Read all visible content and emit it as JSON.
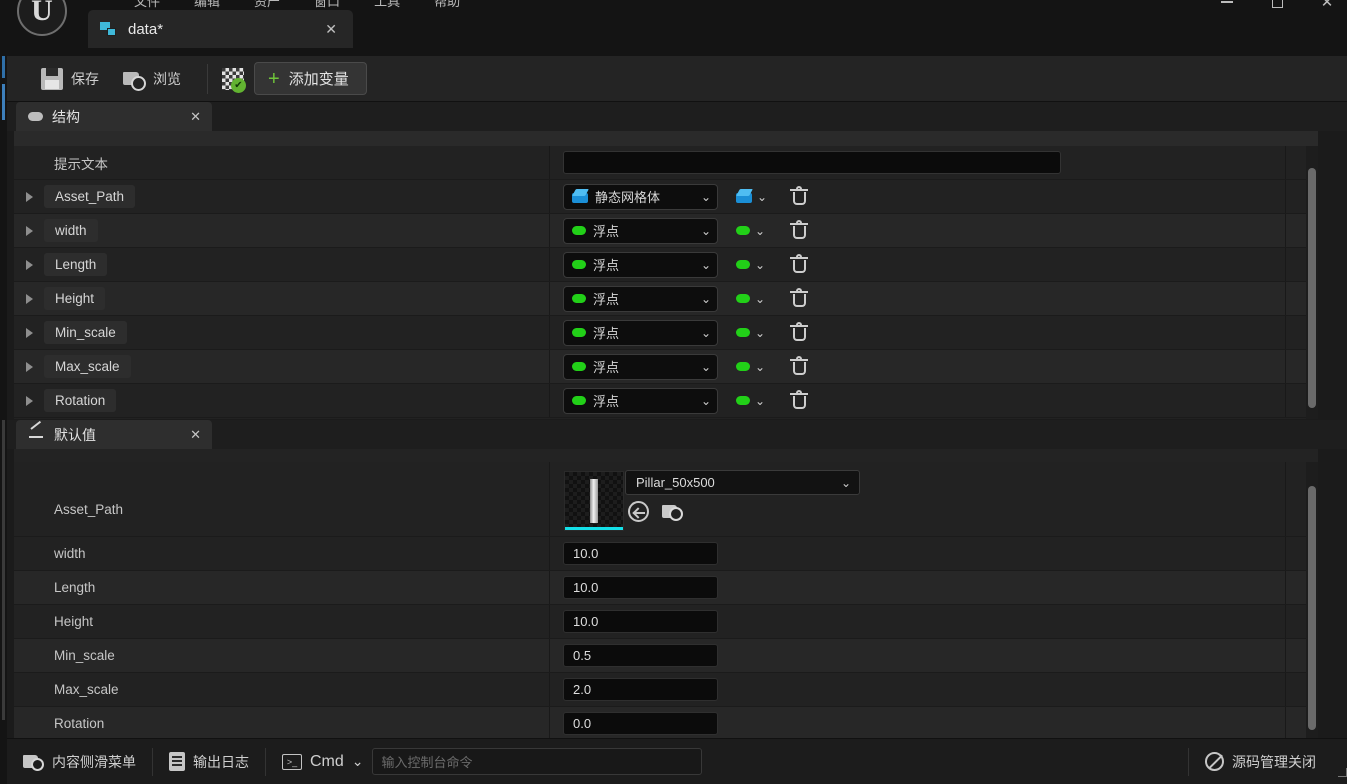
{
  "window": {
    "menu_items": [
      "文件",
      "编辑",
      "资产",
      "窗口",
      "工具",
      "帮助"
    ],
    "controls": {
      "minimize": "−",
      "maximize": "□",
      "close": "✕"
    }
  },
  "document_tab": {
    "label": "data*",
    "close": "✕",
    "icon": "blueprint-struct-icon"
  },
  "toolbar": {
    "save_label": "保存",
    "browse_label": "浏览",
    "compile_icon": "compile-status-good-icon",
    "add_variable_label": "添加变量",
    "add_variable_plus": "+"
  },
  "structure_panel": {
    "title": "结构",
    "close": "✕",
    "tooltip_row": {
      "label": "提示文本",
      "value": ""
    },
    "rows": [
      {
        "name": "Asset_Path",
        "type": "静态网格体",
        "type_icon": "mesh-icon",
        "container_icon": "mesh-icon"
      },
      {
        "name": "width",
        "type": "浮点",
        "type_icon": "float-pin",
        "container_icon": "float-pin"
      },
      {
        "name": "Length",
        "type": "浮点",
        "type_icon": "float-pin",
        "container_icon": "float-pin"
      },
      {
        "name": "Height",
        "type": "浮点",
        "type_icon": "float-pin",
        "container_icon": "float-pin"
      },
      {
        "name": "Min_scale",
        "type": "浮点",
        "type_icon": "float-pin",
        "container_icon": "float-pin"
      },
      {
        "name": "Max_scale",
        "type": "浮点",
        "type_icon": "float-pin",
        "container_icon": "float-pin"
      },
      {
        "name": "Rotation",
        "type": "浮点",
        "type_icon": "float-pin",
        "container_icon": "float-pin"
      }
    ]
  },
  "defaults_panel": {
    "title": "默认值",
    "close": "✕",
    "asset_row": {
      "label": "Asset_Path",
      "asset_name": "Pillar_50x500"
    },
    "rows": [
      {
        "label": "width",
        "value": "10.0"
      },
      {
        "label": "Length",
        "value": "10.0"
      },
      {
        "label": "Height",
        "value": "10.0"
      },
      {
        "label": "Min_scale",
        "value": "0.5"
      },
      {
        "label": "Max_scale",
        "value": "2.0"
      },
      {
        "label": "Rotation",
        "value": "0.0"
      }
    ]
  },
  "statusbar": {
    "content_drawer_label": "内容侧滑菜单",
    "output_log_label": "输出日志",
    "cmd_label": "Cmd",
    "cmd_placeholder": "输入控制台命令",
    "source_control_label": "源码管理关闭"
  },
  "colors": {
    "accent_blue": "#2f6fa8",
    "float_pin_green": "#22d018",
    "mesh_blue": "#1b8fd6",
    "add_plus_green": "#6fc43a",
    "thumb_cyan": "#14e0e8"
  }
}
